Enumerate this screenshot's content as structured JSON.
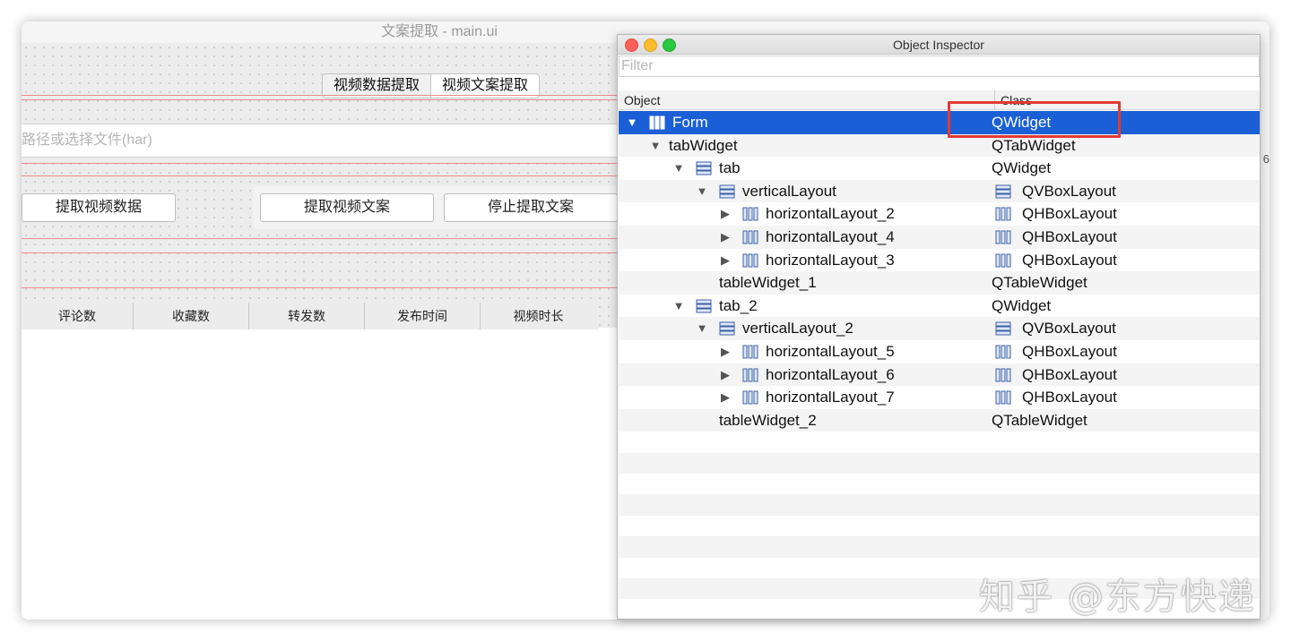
{
  "main_window": {
    "title": "文案提取 - main.ui",
    "tabs": [
      {
        "label": "视频数据提取"
      },
      {
        "label": "视频文案提取"
      }
    ],
    "path_input": {
      "placeholder": "路径或选择文件(har)"
    },
    "buttons": {
      "extract_data": "提取视频数据",
      "extract_copy": "提取视频文案",
      "stop_extract": "停止提取文案"
    },
    "table_headers": [
      "评论数",
      "收藏数",
      "转发数",
      "发布时间",
      "视频时长"
    ],
    "edge_glyph": "6"
  },
  "inspector": {
    "title": "Object Inspector",
    "filter_placeholder": "Filter",
    "columns": {
      "object": "Object",
      "class": "Class"
    },
    "rows": [
      {
        "name": "Form",
        "class": "QWidget",
        "depth": 0,
        "expander": "open",
        "icon": "grid-layout-icon",
        "class_icon": ""
      },
      {
        "name": "tabWidget",
        "class": "QTabWidget",
        "depth": 1,
        "expander": "open",
        "icon": "",
        "class_icon": ""
      },
      {
        "name": "tab",
        "class": "QWidget",
        "depth": 2,
        "expander": "open",
        "icon": "vertical-layout-icon",
        "class_icon": ""
      },
      {
        "name": "verticalLayout",
        "class": "QVBoxLayout",
        "depth": 3,
        "expander": "open",
        "icon": "vertical-layout-icon",
        "class_icon": "vertical-layout-icon"
      },
      {
        "name": "horizontalLayout_2",
        "class": "QHBoxLayout",
        "depth": 4,
        "expander": "closed",
        "icon": "horizontal-layout-icon",
        "class_icon": "horizontal-layout-icon"
      },
      {
        "name": "horizontalLayout_4",
        "class": "QHBoxLayout",
        "depth": 4,
        "expander": "closed",
        "icon": "horizontal-layout-icon",
        "class_icon": "horizontal-layout-icon"
      },
      {
        "name": "horizontalLayout_3",
        "class": "QHBoxLayout",
        "depth": 4,
        "expander": "closed",
        "icon": "horizontal-layout-icon",
        "class_icon": "horizontal-layout-icon"
      },
      {
        "name": "tableWidget_1",
        "class": "QTableWidget",
        "depth": 3,
        "expander": "none",
        "icon": "",
        "class_icon": ""
      },
      {
        "name": "tab_2",
        "class": "QWidget",
        "depth": 2,
        "expander": "open",
        "icon": "vertical-layout-icon",
        "class_icon": ""
      },
      {
        "name": "verticalLayout_2",
        "class": "QVBoxLayout",
        "depth": 3,
        "expander": "open",
        "icon": "vertical-layout-icon",
        "class_icon": "vertical-layout-icon"
      },
      {
        "name": "horizontalLayout_5",
        "class": "QHBoxLayout",
        "depth": 4,
        "expander": "closed",
        "icon": "horizontal-layout-icon",
        "class_icon": "horizontal-layout-icon"
      },
      {
        "name": "horizontalLayout_6",
        "class": "QHBoxLayout",
        "depth": 4,
        "expander": "closed",
        "icon": "horizontal-layout-icon",
        "class_icon": "horizontal-layout-icon"
      },
      {
        "name": "horizontalLayout_7",
        "class": "QHBoxLayout",
        "depth": 4,
        "expander": "closed",
        "icon": "horizontal-layout-icon",
        "class_icon": "horizontal-layout-icon"
      },
      {
        "name": "tableWidget_2",
        "class": "QTableWidget",
        "depth": 3,
        "expander": "none",
        "icon": "",
        "class_icon": ""
      }
    ],
    "selected_row": 0
  },
  "annotation": {
    "color": "#e43a32"
  },
  "watermark": "知乎 @东方快递",
  "colors": {
    "selection": "#1a5fd6",
    "accent_red": "#e43a32"
  }
}
